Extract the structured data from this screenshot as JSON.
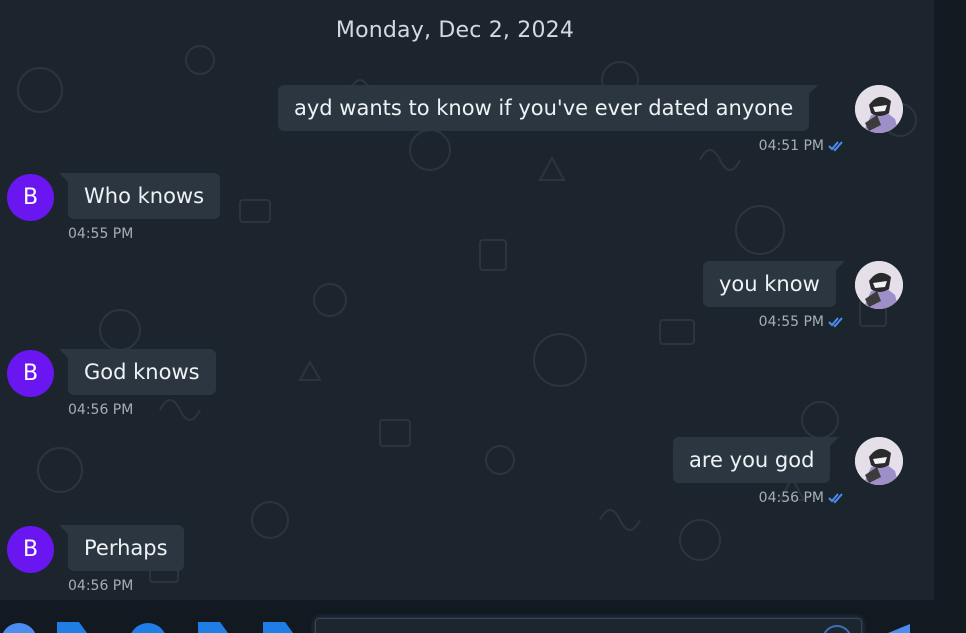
{
  "date_separator": "Monday, Dec 2, 2024",
  "messages": [
    {
      "direction": "out",
      "text": "ayd wants to know if you've ever dated anyone",
      "time": "04:51 PM",
      "read": true
    },
    {
      "direction": "in",
      "sender_initial": "B",
      "text": "Who knows",
      "time": "04:55 PM"
    },
    {
      "direction": "out",
      "text": "you know",
      "time": "04:55 PM",
      "read": true
    },
    {
      "direction": "in",
      "sender_initial": "B",
      "text": "God knows",
      "time": "04:56 PM"
    },
    {
      "direction": "out",
      "text": "are you god",
      "time": "04:56 PM",
      "read": true
    },
    {
      "direction": "in",
      "sender_initial": "B",
      "text": "Perhaps",
      "time": "04:56 PM"
    }
  ],
  "colors": {
    "chat_background": "#1c252e",
    "bubble": "#2b3640",
    "avatar_purple": "#6a16f0",
    "read_check": "#4a8df0",
    "toolbar_blue": "#1f7de6"
  },
  "composer": {
    "icons": [
      "emoji-icon",
      "sticker-icon",
      "gif-icon",
      "attach-icon",
      "image-icon"
    ],
    "input_value": "",
    "send_icon": "send-icon"
  }
}
